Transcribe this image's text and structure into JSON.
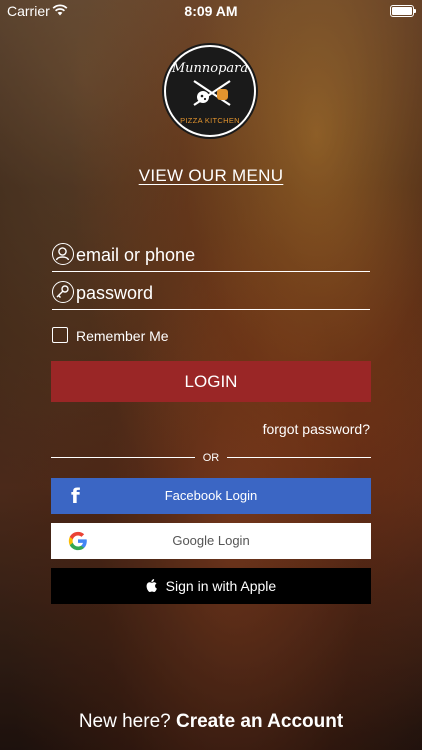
{
  "status_bar": {
    "carrier": "Carrier",
    "time": "8:09 AM"
  },
  "logo": {
    "brand": "Munnopara",
    "tagline": "PIZZA KITCHEN"
  },
  "menu_link": "VIEW OUR MENU",
  "email": {
    "placeholder": "email or phone",
    "icon": "user-icon"
  },
  "password": {
    "placeholder": "password",
    "icon": "key-icon"
  },
  "remember_label": "Remember Me",
  "login_label": "LOGIN",
  "forgot_label": "forgot password?",
  "or_label": "OR",
  "facebook_label": "Facebook Login",
  "google_label": "Google Login",
  "apple_label": "Sign in with Apple",
  "footer": {
    "prefix": "New here?",
    "link": "Create an Account"
  },
  "colors": {
    "login": "#9a2626",
    "facebook": "#3b66c4",
    "google": "#ffffff",
    "apple": "#000000",
    "brand_accent": "#e3942e"
  }
}
